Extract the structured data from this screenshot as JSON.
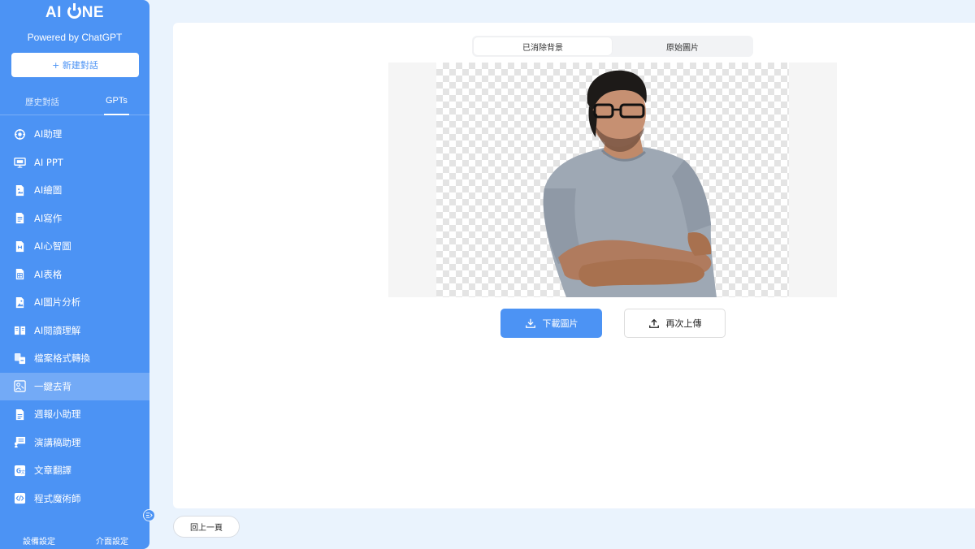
{
  "sidebar": {
    "logo_left": "AI ",
    "logo_right": "NE",
    "powered_by": "Powered by ChatGPT",
    "new_chat_label": "+ 新建對話",
    "tabs": [
      {
        "label": "歷史對話"
      },
      {
        "label": "GPTs"
      }
    ],
    "items": [
      {
        "label": "AI助理",
        "icon": "assistant-icon"
      },
      {
        "label": "AI PPT",
        "icon": "ppt-icon"
      },
      {
        "label": "AI繪圖",
        "icon": "drawing-icon"
      },
      {
        "label": "AI寫作",
        "icon": "writing-icon"
      },
      {
        "label": "AI心智圖",
        "icon": "mindmap-icon"
      },
      {
        "label": "AI表格",
        "icon": "table-icon"
      },
      {
        "label": "AI圖片分析",
        "icon": "image-analysis-icon"
      },
      {
        "label": "AI閱讀理解",
        "icon": "reading-icon"
      },
      {
        "label": "檔案格式轉換",
        "icon": "file-convert-icon"
      },
      {
        "label": "一鍵去背",
        "icon": "remove-bg-icon",
        "active": true
      },
      {
        "label": "週報小助理",
        "icon": "weekly-report-icon"
      },
      {
        "label": "演講稿助理",
        "icon": "speech-icon"
      },
      {
        "label": "文章翻譯",
        "icon": "translate-icon"
      },
      {
        "label": "程式魔術師",
        "icon": "code-icon"
      }
    ],
    "footer": {
      "device_settings": "設備設定",
      "ui_settings": "介面設定"
    }
  },
  "main": {
    "segments": [
      {
        "label": "已消除背景",
        "selected": true
      },
      {
        "label": "原始圖片",
        "selected": false
      }
    ],
    "download_label": "下載圖片",
    "reupload_label": "再次上傳",
    "back_label": "回上一頁"
  },
  "colors": {
    "accent": "#4c93f4",
    "background": "#eaf3fd"
  }
}
